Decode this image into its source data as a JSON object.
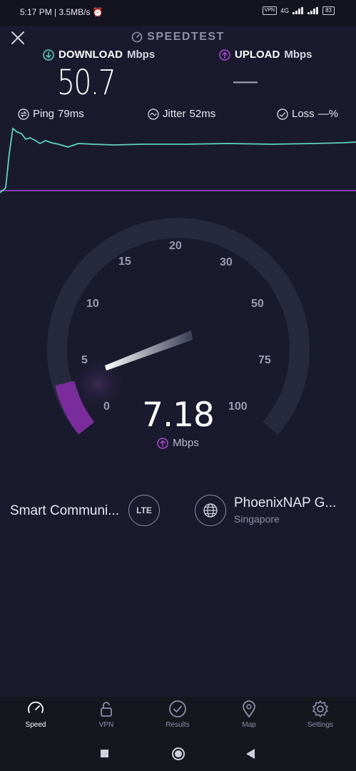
{
  "status": {
    "time": "5:17 PM",
    "net_speed": "3.5MB/s",
    "vpn": "VPN",
    "network": "4G",
    "battery": "83"
  },
  "header": {
    "brand": "SPEEDTEST"
  },
  "download": {
    "label": "DOWNLOAD",
    "unit": "Mbps",
    "value": "50.7"
  },
  "upload": {
    "label": "UPLOAD",
    "unit": "Mbps",
    "value": "—"
  },
  "stats": {
    "ping_label": "Ping",
    "ping_value": "79ms",
    "jitter_label": "Jitter",
    "jitter_value": "52ms",
    "loss_label": "Loss",
    "loss_value": "—%"
  },
  "gauge": {
    "ticks": [
      "0",
      "5",
      "10",
      "15",
      "20",
      "30",
      "50",
      "75",
      "100"
    ],
    "value": "7.18",
    "unit": "Mbps",
    "colors": {
      "track": "#272a3f",
      "fill": "#7b2c9c",
      "download_line": "#5fd2c4",
      "upload_line": "#a84cd4"
    }
  },
  "server": {
    "isp": "Smart Communi...",
    "connection": "LTE",
    "host": "PhoenixNAP G...",
    "location": "Singapore"
  },
  "nav": {
    "items": [
      {
        "label": "Speed",
        "icon": "speedometer-icon"
      },
      {
        "label": "VPN",
        "icon": "unlock-icon"
      },
      {
        "label": "Results",
        "icon": "check-circle-icon"
      },
      {
        "label": "Map",
        "icon": "map-pin-icon"
      },
      {
        "label": "Settings",
        "icon": "gear-icon"
      }
    ]
  }
}
